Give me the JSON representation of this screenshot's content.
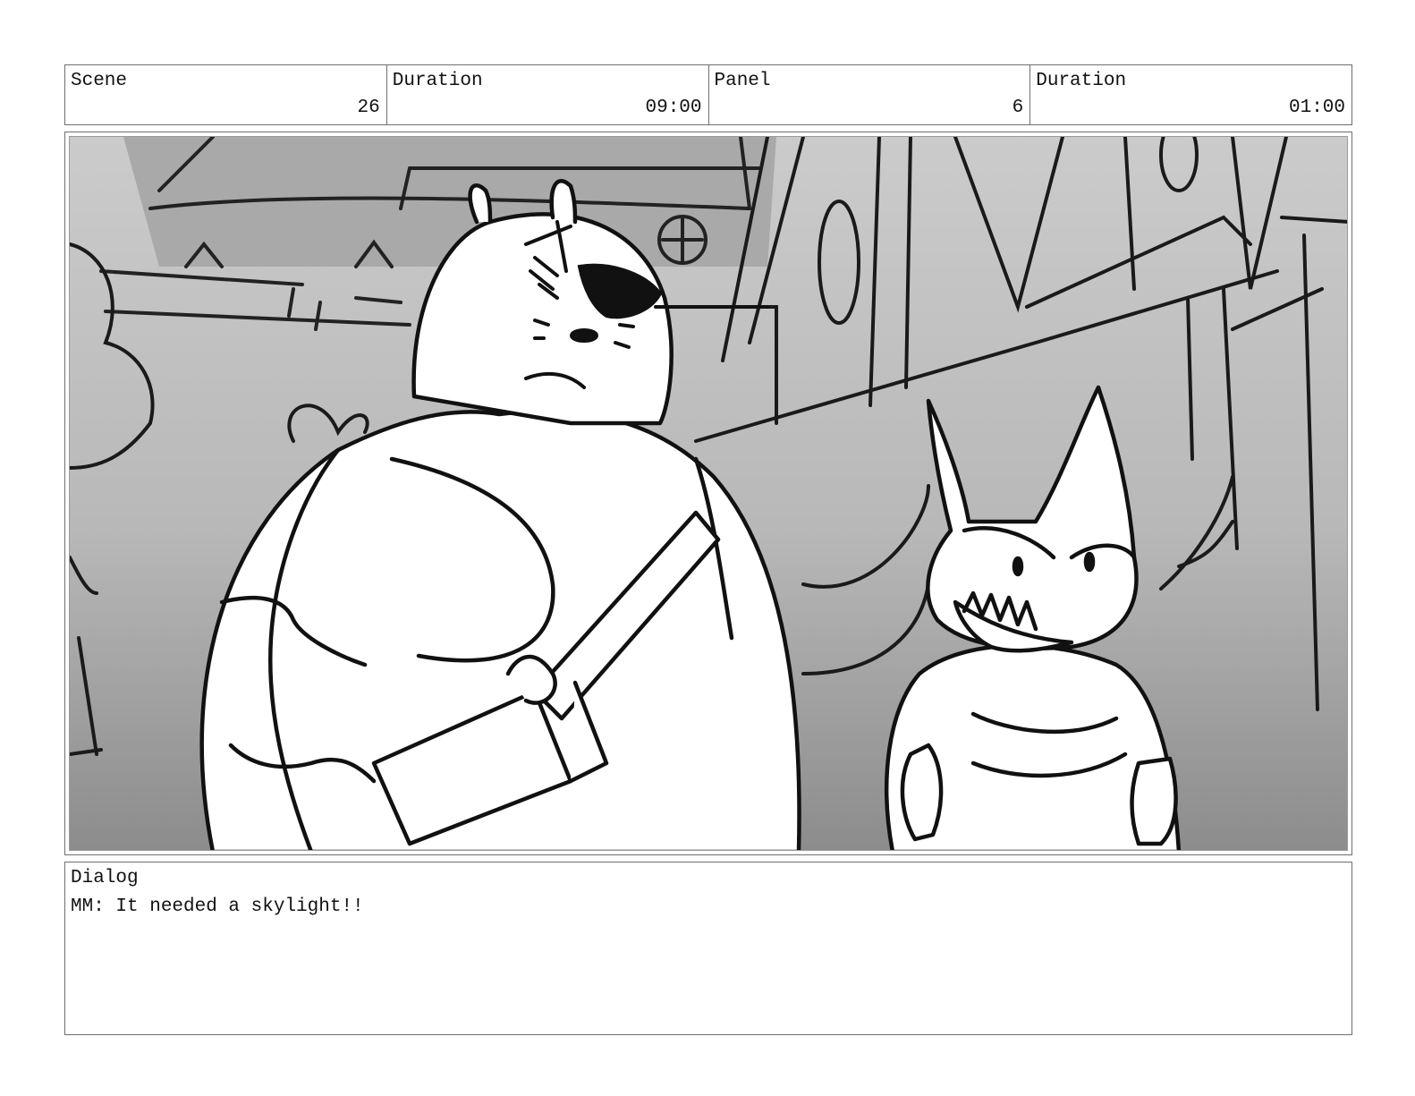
{
  "header": {
    "scene_label": "Scene",
    "scene_value": "26",
    "scene_duration_label": "Duration",
    "scene_duration_value": "09:00",
    "panel_label": "Panel",
    "panel_value": "6",
    "panel_duration_label": "Duration",
    "panel_duration_value": "01:00"
  },
  "dialog": {
    "label": "Dialog",
    "text": "MM: It needed a skylight!!"
  }
}
